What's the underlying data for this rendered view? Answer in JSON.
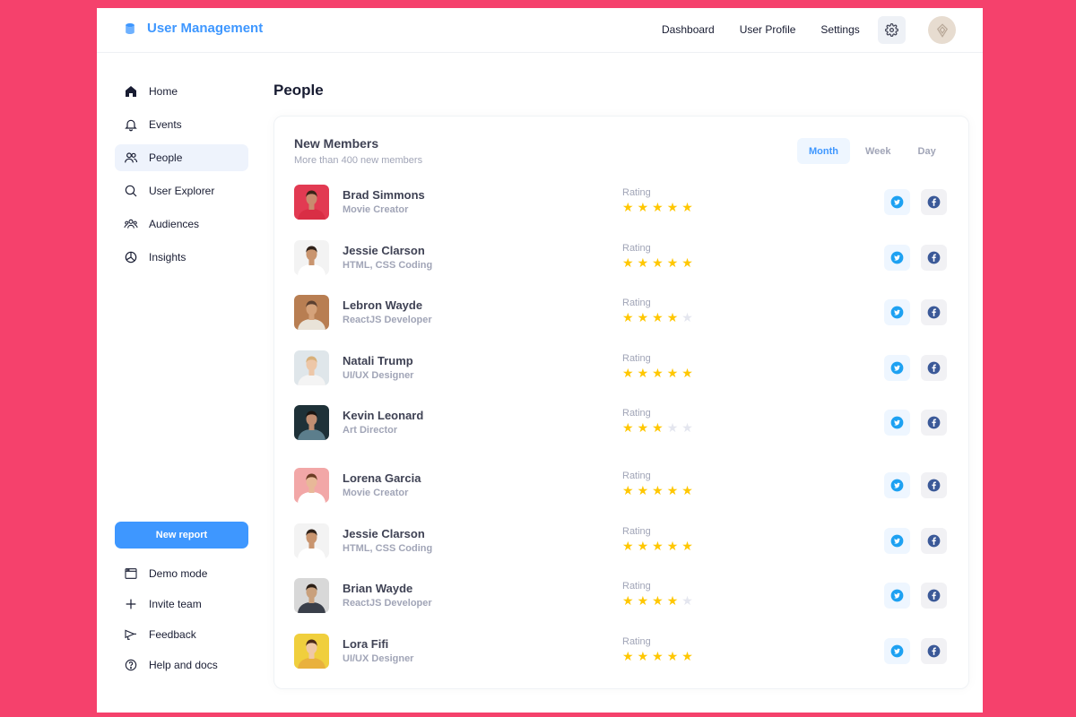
{
  "header": {
    "title": "User Management",
    "nav": [
      "Dashboard",
      "User Profile",
      "Settings"
    ]
  },
  "sidebar": {
    "items": [
      {
        "label": "Home",
        "icon": "home-icon"
      },
      {
        "label": "Events",
        "icon": "bell-icon"
      },
      {
        "label": "People",
        "icon": "users-icon",
        "active": true
      },
      {
        "label": "User Explorer",
        "icon": "search-icon"
      },
      {
        "label": "Audiences",
        "icon": "audience-icon"
      },
      {
        "label": "Insights",
        "icon": "pie-chart-icon"
      }
    ],
    "new_report": "New report",
    "footer_items": [
      {
        "label": "Demo mode",
        "icon": "window-icon"
      },
      {
        "label": "Invite team",
        "icon": "plus-icon"
      },
      {
        "label": "Feedback",
        "icon": "megaphone-icon"
      },
      {
        "label": "Help and docs",
        "icon": "help-icon"
      }
    ]
  },
  "main": {
    "page_title": "People",
    "card": {
      "title": "New Members",
      "subtitle": "More than 400 new members",
      "tabs": [
        {
          "label": "Month",
          "active": true
        },
        {
          "label": "Week",
          "active": false
        },
        {
          "label": "Day",
          "active": false
        }
      ],
      "rating_label": "Rating",
      "members": [
        {
          "name": "Brad Simmons",
          "role": "Movie Creator",
          "rating": 5,
          "bg": "#e23a52",
          "shirt": "#d92e45",
          "skin": "#c98b6e",
          "hair": "#3a2418"
        },
        {
          "name": "Jessie Clarson",
          "role": "HTML, CSS Coding",
          "rating": 5,
          "bg": "#f3f3f3",
          "shirt": "#ffffff",
          "skin": "#c9956f",
          "hair": "#2f2119"
        },
        {
          "name": "Lebron Wayde",
          "role": "ReactJS Developer",
          "rating": 4,
          "bg": "#b87e52",
          "shirt": "#e9e3d8",
          "skin": "#d5a27a",
          "hair": "#5c4030"
        },
        {
          "name": "Natali Trump",
          "role": "UI/UX Designer",
          "rating": 5,
          "bg": "#dfe6ea",
          "shirt": "#f4f4f4",
          "skin": "#edc7a8",
          "hair": "#d8b07a"
        },
        {
          "name": "Kevin Leonard",
          "role": "Art Director",
          "rating": 3,
          "bg": "#1e3138",
          "shirt": "#5c7e8c",
          "skin": "#c08e72",
          "hair": "#1b1410"
        },
        {
          "name": "Lorena Garcia",
          "role": "Movie Creator",
          "rating": 5,
          "bg": "#f2a7a7",
          "shirt": "#ffffff",
          "skin": "#e8b898",
          "hair": "#6b3b24"
        },
        {
          "name": "Jessie Clarson",
          "role": "HTML, CSS Coding",
          "rating": 5,
          "bg": "#f3f3f3",
          "shirt": "#ffffff",
          "skin": "#c9956f",
          "hair": "#2f2119"
        },
        {
          "name": "Brian Wayde",
          "role": "ReactJS Developer",
          "rating": 4,
          "bg": "#d8d8d8",
          "shirt": "#3a3f4a",
          "skin": "#c9a07c",
          "hair": "#2a1e15"
        },
        {
          "name": "Lora Fifi",
          "role": "UI/UX Designer",
          "rating": 5,
          "bg": "#f0cf3d",
          "shirt": "#e9b13d",
          "skin": "#efc8a6",
          "hair": "#4b2a19"
        }
      ]
    }
  },
  "colors": {
    "accent": "#3e97ff",
    "star": "#ffc700",
    "twitter": "#1da1f2",
    "facebook": "#3b5998",
    "background": "#f5416c"
  }
}
